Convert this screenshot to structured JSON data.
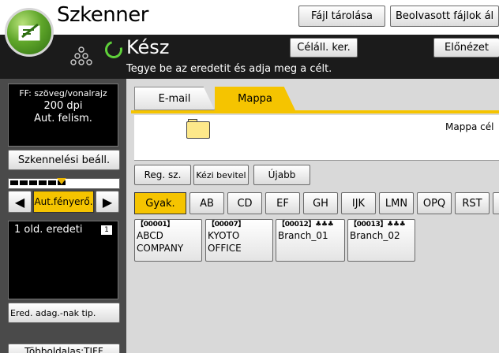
{
  "header": {
    "title": "Szkenner",
    "file_store_label": "Fájl tárolása",
    "scanned_files_label": "Beolvasott fájlok ál"
  },
  "status": {
    "state": "Kész",
    "message": "Tegye be az eredetit és adja meg a célt.",
    "dest_search_label": "Céláll. ker.",
    "preview_label": "Előnézet"
  },
  "left_panel": {
    "settings_line1": "FF: szöveg/vonalrajz",
    "settings_line2": "200 dpi",
    "settings_line3": "Aut. felism.",
    "scan_settings_label": "Szkennelési beáll.",
    "density_left": "◀",
    "density_auto_label": "Aut.fényerő.",
    "density_right": "▶",
    "original_label": "1 old. eredeti",
    "original_icon": "1",
    "orig_feed_label": "Ered. adag.-nak tip.",
    "tiff_label": "Többoldalas:TIFF"
  },
  "main": {
    "tabs": [
      {
        "label": "E-mail"
      },
      {
        "label": "Mappa"
      }
    ],
    "folder_dest_text": "Mappa cél",
    "reg_no_label": "Reg. sz.",
    "manual_label": "Kézi bevitel",
    "newer_label": "Újabb",
    "letters": [
      "Gyak.",
      "AB",
      "CD",
      "EF",
      "GH",
      "IJK",
      "LMN",
      "OPQ",
      "RST",
      ""
    ],
    "destinations": [
      {
        "num": "【00001】",
        "name": "ABCD COMPANY"
      },
      {
        "num": "【00007】",
        "name": "KYOTO OFFICE"
      },
      {
        "num": "【00012】♣♣♣",
        "name": "Branch_01"
      },
      {
        "num": "【00013】♣♣♣",
        "name": "Branch_02"
      }
    ]
  },
  "colors": {
    "accent_yellow": "#f5c400",
    "status_bg": "#1b1b1b",
    "panel_gray": "#4a4a4a",
    "main_bg": "#d9d9d9",
    "ready_green": "#5fd13a"
  }
}
